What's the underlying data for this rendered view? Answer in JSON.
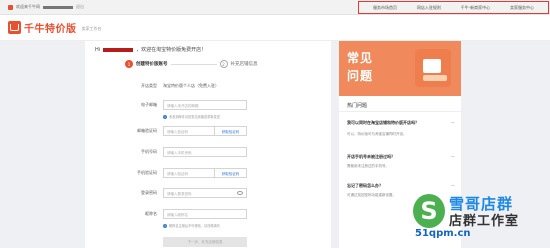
{
  "topbar": {
    "greeting": "欢迎来千牛网",
    "logout": "退出",
    "nav": [
      "服务市场首页",
      "网店入驻规则",
      "千牛·新商家中心",
      "卖家服务中心"
    ]
  },
  "header": {
    "logo_text": "千牛特价版",
    "logo_sub": "卖家工作台"
  },
  "form": {
    "welcome_prefix": "Hi",
    "welcome": "，欢迎在淘宝特价版免费开店！",
    "steps": [
      {
        "num": "1",
        "label": "创建特价版账号"
      },
      {
        "num": "2",
        "label": "补充店铺信息"
      }
    ],
    "fields": [
      {
        "label": "开店类型",
        "value": "淘宝特价版个人店（免费入驻）"
      },
      {
        "label": "电子邮箱",
        "placeholder": "请输入未开店的邮箱"
      },
      {
        "label": "邮箱验证码",
        "placeholder": "请输入验证码",
        "action": "获取验证码"
      },
      {
        "label": "手机号码",
        "placeholder": "请输入手机号码"
      },
      {
        "label": "手机验证码",
        "placeholder": "请输入验证码",
        "action": "获取验证码"
      },
      {
        "label": "登录密码",
        "placeholder": "请输入登录密码"
      },
      {
        "label": "昵称名",
        "placeholder": "请输入昵称名"
      }
    ],
    "email_hint": "未收到邮件请检查垃圾箱或重新发送",
    "nickname_hint": "昵称名注册后不可修改，请谨慎填写",
    "submit_label": "下一步，补充店铺信息"
  },
  "sidebar": {
    "banner_line1": "常见",
    "banner_line2": "问题",
    "faq_title": "热门问题",
    "faqs": [
      {
        "q": "我可以同时在淘宝店铺和特价版开店吗？",
        "a": "可以，特价版可与淘宝店铺同时开设。"
      },
      {
        "q": "开店手机号未被注册过吗？",
        "a": "需使用未注册过的手机号。"
      },
      {
        "q": "忘记了密码怎么办？",
        "a": "可通过找回密码功能重新设置。"
      }
    ]
  },
  "watermark": {
    "brand": "雪哥店群",
    "brand2": "店群工作室",
    "url": "51qpm.cn"
  }
}
